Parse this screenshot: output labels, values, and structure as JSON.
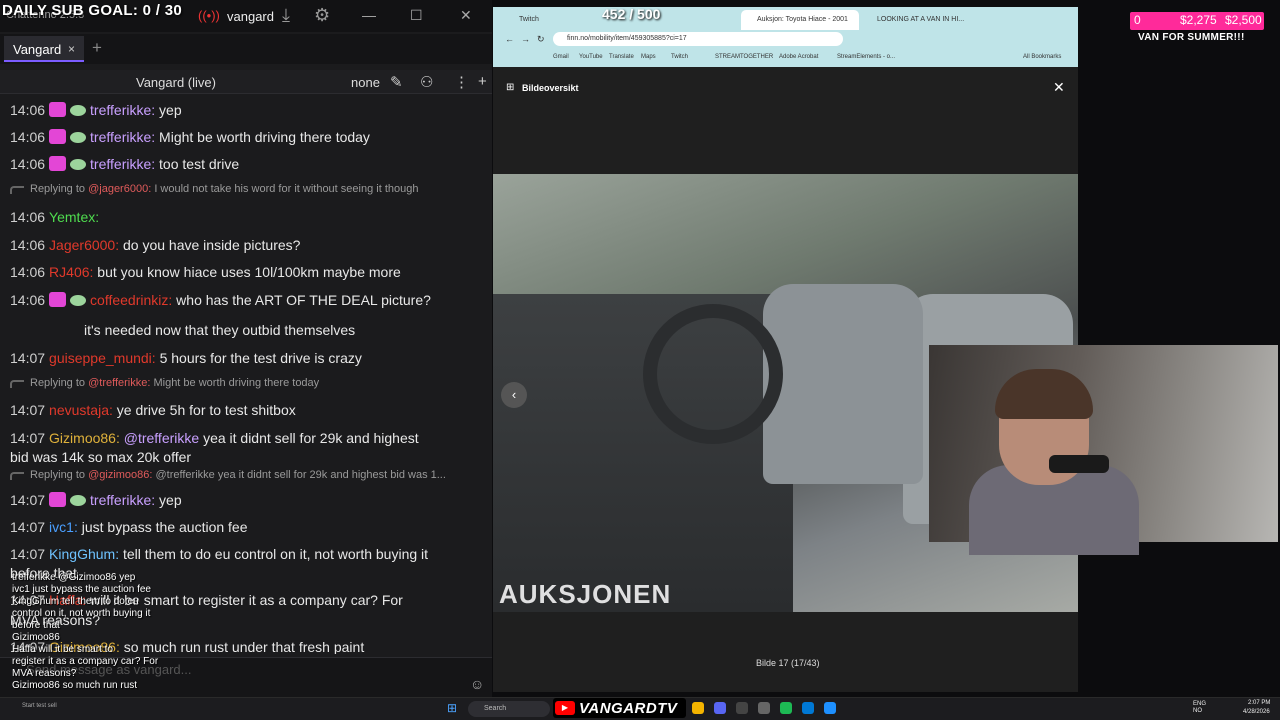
{
  "stream_overlay": {
    "sub_goal": "DAILY SUB GOAL: 0 / 30",
    "viewer_count": "452 / 500",
    "goal_current": "0",
    "goal_amount": "$2,275",
    "goal_target": "$2,500",
    "goal_label": "VAN FOR SUMMER!!!"
  },
  "chatterino": {
    "app_title": "Chatterino 2.5.3",
    "account": "vangard",
    "tab_label": "Vangard",
    "tab_close": "×",
    "tab_add": "+",
    "channel": "Vangard (live)",
    "mode": "none",
    "input_placeholder": "Send message as vangard...",
    "messages": [
      {
        "time": "14:06",
        "user": "trefferikke:",
        "user_color": "#c9a0ff",
        "text": "yep"
      },
      {
        "time": "14:06",
        "user": "trefferikke:",
        "user_color": "#c9a0ff",
        "text": "Might be worth driving there today"
      },
      {
        "time": "14:06",
        "user": "trefferikke:",
        "user_color": "#c9a0ff",
        "text": "too test drive"
      },
      {
        "reply_prefix": "Replying to",
        "reply_to": "@jager6000:",
        "reply_text": "I would not take his word for it without seeing it though"
      },
      {
        "time": "14:06",
        "user": "Yemtex:",
        "user_color": "#4fdc4f",
        "text": ""
      },
      {
        "time": "14:06",
        "user": "Jager6000:",
        "user_color": "#e0392b",
        "text": "do you have inside pictures?"
      },
      {
        "time": "14:06",
        "user": "RJ406:",
        "user_color": "#e0392b",
        "text": "but you know hiace uses 10l/100km maybe more"
      },
      {
        "time": "14:06",
        "user": "coffeedrinkiz:",
        "user_color": "#e0392b",
        "text": "who has the ART OF THE DEAL picture?"
      },
      {
        "time": "",
        "user": "",
        "user_color": "#e8e8e8",
        "text": "it's needed now that they outbid themselves"
      },
      {
        "time": "14:07",
        "user": "guiseppe_mundi:",
        "user_color": "#e0392b",
        "text": "5 hours for the test drive is crazy"
      },
      {
        "reply_prefix": "Replying to",
        "reply_to": "@trefferikke:",
        "reply_text": "Might be worth driving there today"
      },
      {
        "time": "14:07",
        "user": "nevustaja:",
        "user_color": "#e0392b",
        "text": "ye drive 5h for to test shitbox"
      },
      {
        "time": "14:07",
        "user": "Gizimoo86:",
        "user_color": "#e0b23b",
        "mention": "@trefferikke",
        "text": "yea it didnt sell for 29k and highest"
      },
      {
        "time": "",
        "user": "",
        "user_color": "#e8e8e8",
        "text": "bid was 14k so max 20k offer"
      },
      {
        "reply_prefix": "Replying to",
        "reply_to": "@gizimoo86:",
        "reply_text": "@trefferikke yea it didnt sell for 29k and highest bid was 1..."
      },
      {
        "time": "14:07",
        "user": "trefferikke:",
        "user_color": "#c9a0ff",
        "text": "yep"
      },
      {
        "time": "14:07",
        "user": "ivc1:",
        "user_color": "#4a9fff",
        "text": "just bypass the auction fee"
      },
      {
        "time": "14:07",
        "user": "KingGhum:",
        "user_color": "#6fc3ff",
        "text": "tell them to do eu control on it, not worth buying it"
      },
      {
        "time": "",
        "user": "",
        "user_color": "#e8e8e8",
        "text": "before that"
      },
      {
        "time": "14:07",
        "user": "Haffa:",
        "user_color": "#e0392b",
        "text": "will it be smart to register it as a company car? For"
      },
      {
        "time": "",
        "user": "",
        "user_color": "#e8e8e8",
        "text": "MVA reasons?"
      },
      {
        "time": "14:07",
        "user": "Gizimoo86:",
        "user_color": "#e0b23b",
        "text": "so much run rust under that fresh paint"
      }
    ],
    "overlay_lines": [
      "trefferikke  @Gizimoo86 yep",
      "ivc1  just bypass the auction fee",
      "KingGhum  tell them to do eu",
      "control on it, not worth buying it",
      "before that",
      "Gizimoo86",
      "Haffa  will it be smart to",
      "register it as a company car? For",
      "MVA reasons?",
      "Gizimoo86  so much run rust"
    ]
  },
  "browser": {
    "tabs": [
      "Twitch",
      "",
      "Auksjon: Toyota Hiace - 2001",
      "LOOKING AT A VAN IN HI..."
    ],
    "url": "finn.no/mobility/item/459305885?ci=17",
    "bookmarks": [
      "Gmail",
      "YouTube",
      "Translate",
      "Maps",
      "Twitch",
      "STREAMTOGETHER",
      "Adobe Acrobat",
      "StreamElements - o...",
      "All Bookmarks"
    ],
    "viewer_title": "Bildeoversikt",
    "watermark": "AUKSJONEN",
    "image_counter": "Bilde 17 (17/43)"
  },
  "taskbar": {
    "search": "Search",
    "youtube_name": "VANGARDTV",
    "lang": "ENG\nNO",
    "time": "2:07 PM",
    "date": "4/28/2026",
    "weather": "Start test sell"
  },
  "colors": {
    "accent_purple": "#7b5cff",
    "goal_pink": "#ff2a9a",
    "sub_badge": "#e346d6"
  }
}
